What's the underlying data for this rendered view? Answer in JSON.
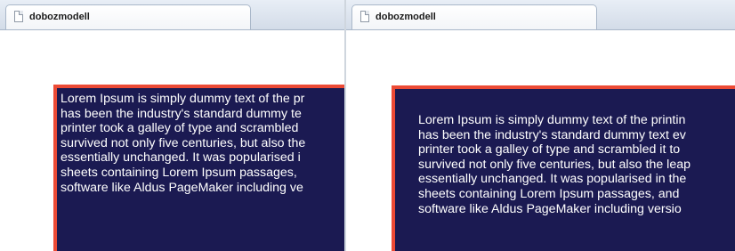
{
  "windows": [
    {
      "tab": {
        "title": "dobozmodell",
        "icon": "page-icon"
      }
    },
    {
      "tab": {
        "title": "dobozmodell",
        "icon": "page-icon"
      }
    }
  ],
  "left_box": {
    "lines": [
      "Lorem Ipsum is simply dummy text of the pr",
      "has been the industry's standard dummy te",
      "printer took a galley of type and scrambled",
      "survived not only five centuries, but also the",
      "essentially unchanged. It was popularised i",
      "sheets containing Lorem Ipsum passages,",
      "software like Aldus PageMaker including ve"
    ]
  },
  "right_box": {
    "lines": [
      "Lorem Ipsum is simply dummy text of the printin",
      "has been the industry's standard dummy text ev",
      "printer took a galley of type and scrambled it to",
      "survived not only five centuries, but also the leap",
      "essentially unchanged. It was popularised in the",
      "sheets containing Lorem Ipsum passages, and",
      "software like Aldus PageMaker including versio"
    ]
  },
  "colors": {
    "box_background": "#1b1a52",
    "box_border": "#ec4a35",
    "text": "#ffffff"
  }
}
